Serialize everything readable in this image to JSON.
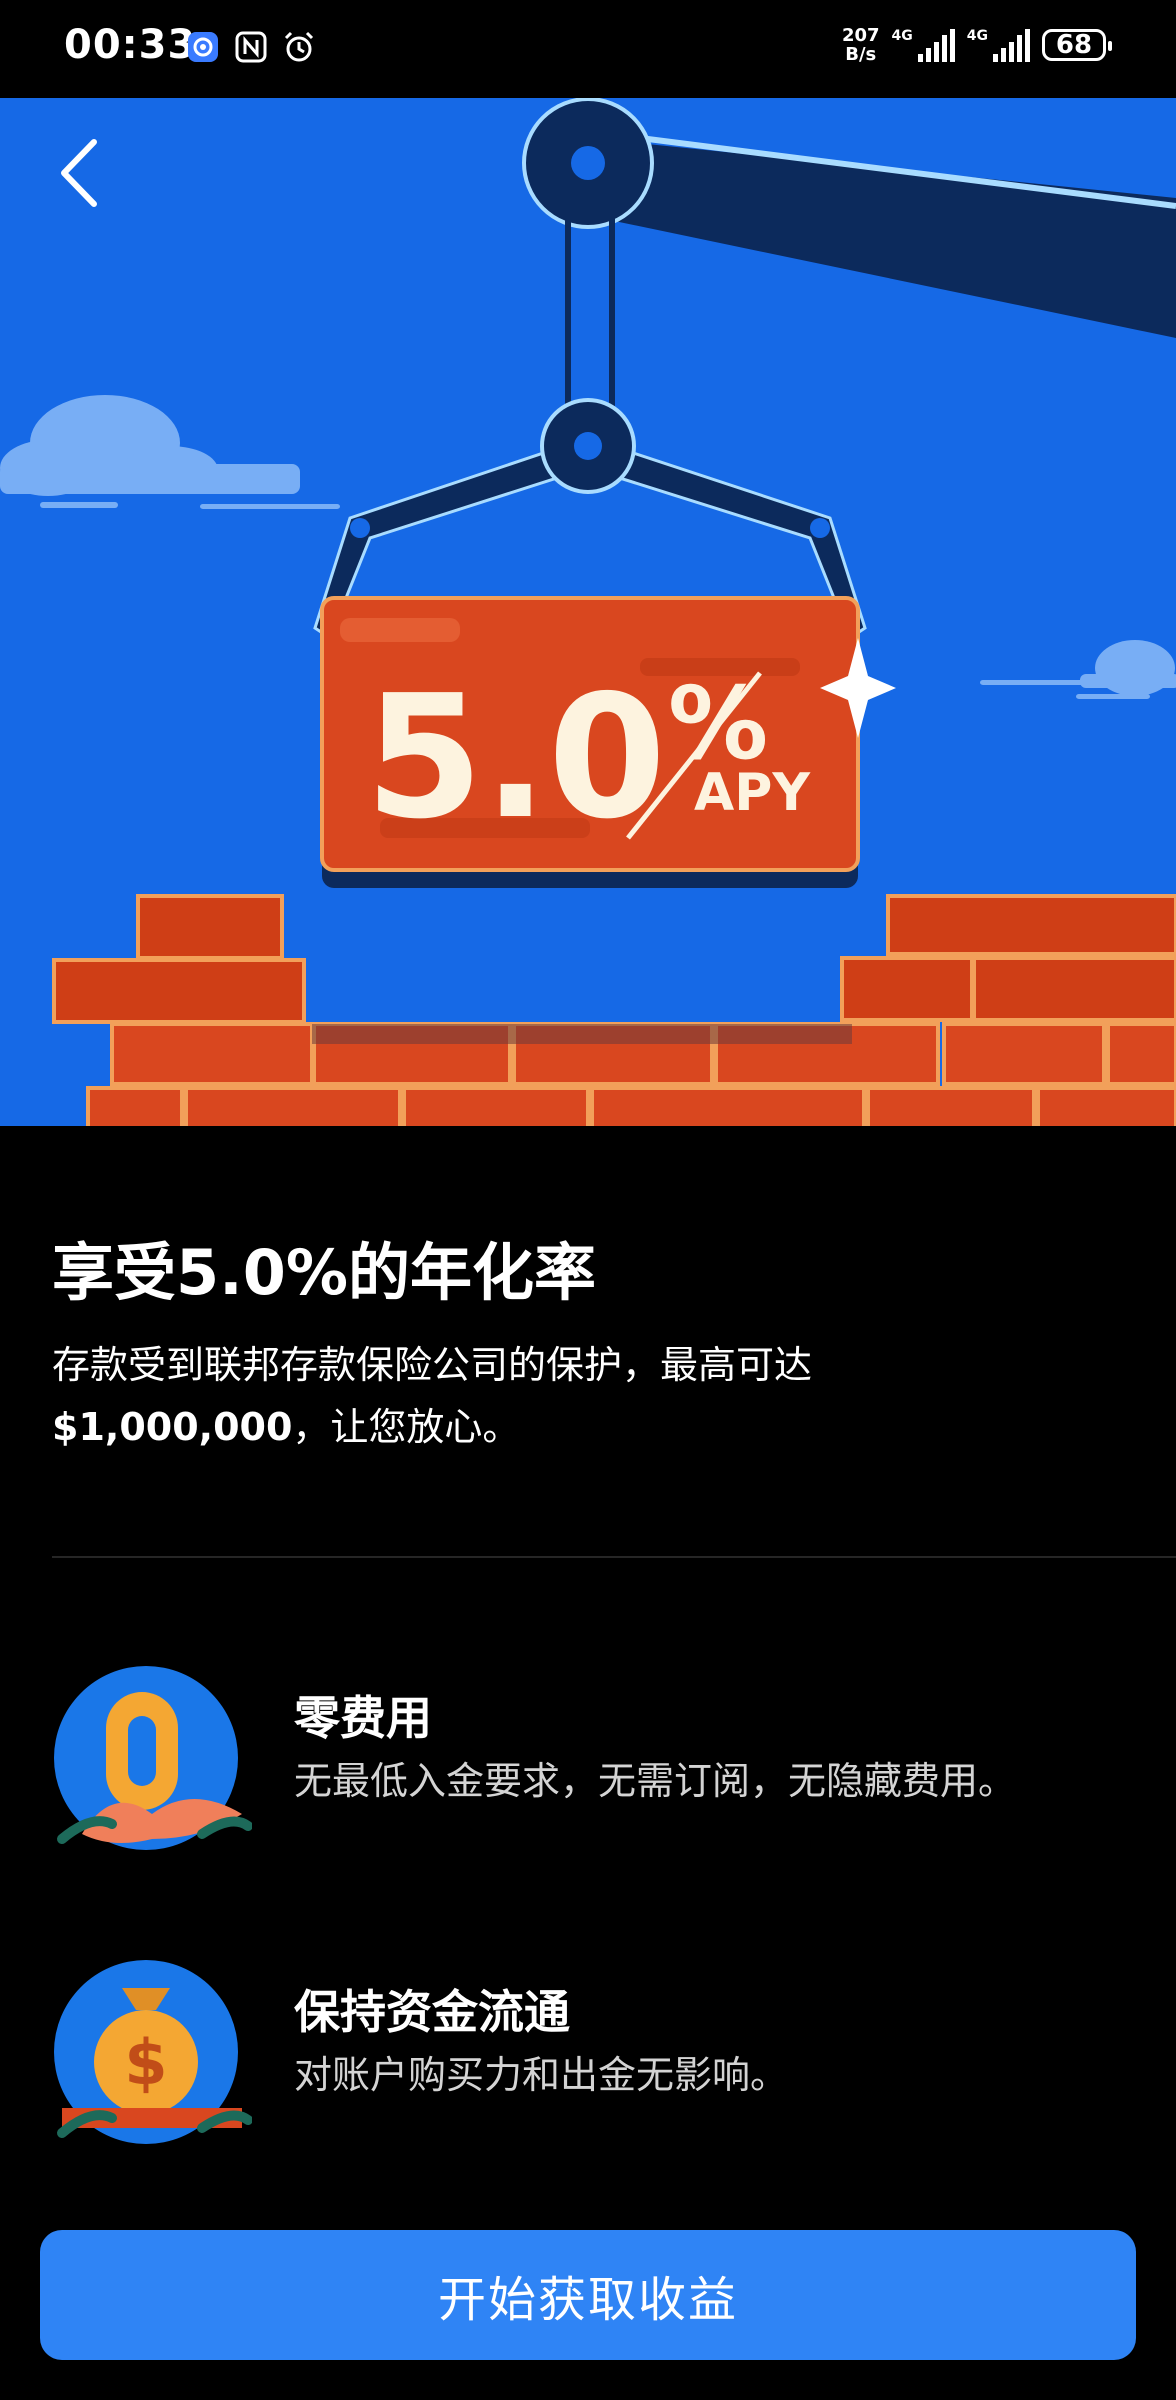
{
  "status_bar": {
    "time": "00:33",
    "net_speed_value": "207",
    "net_speed_unit": "B/s",
    "signal_label_1": "4G",
    "signal_label_2": "4G",
    "battery": "68",
    "icons": [
      "app-notification-icon",
      "nfc-icon",
      "alarm-icon",
      "signal-icon",
      "battery-icon"
    ]
  },
  "hero": {
    "rate": "5.0",
    "percent_sign": "%",
    "apy_label": "APY",
    "back_icon": "chevron-left-icon",
    "colors": {
      "sky": "#1669e6",
      "brick": "#d9471f",
      "crane": "#0c2a5c",
      "text": "#fdf3df"
    }
  },
  "content": {
    "headline_prefix": "享受",
    "headline_rate": "5.0%",
    "headline_suffix": "的年化率",
    "subtitle_line": "存款受到联邦存款保险公司的保护，最高可达",
    "subtitle_amount": "$1,000,000",
    "subtitle_tail": "，让您放心。"
  },
  "features": [
    {
      "icon": "zero-coin-icon",
      "title": "零费用",
      "description": "无最低入金要求，无需订阅，无隐藏费用。"
    },
    {
      "icon": "money-bag-icon",
      "title": "保持资金流通",
      "description": "对账户购买力和出金无影响。"
    }
  ],
  "cta": {
    "label": "开始获取收益",
    "color": "#2f84f5"
  }
}
